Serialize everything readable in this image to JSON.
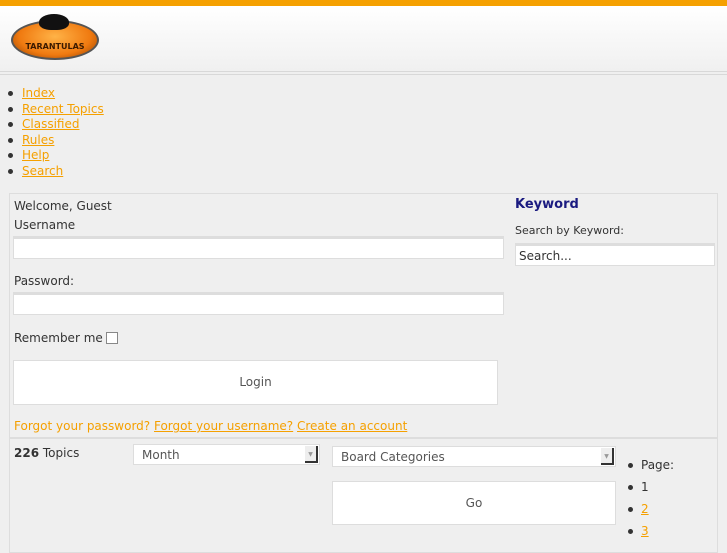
{
  "logo": {
    "text": "TARANTULAS"
  },
  "nav": [
    {
      "label": "Index"
    },
    {
      "label": "Recent Topics"
    },
    {
      "label": "Classified"
    },
    {
      "label": "Rules"
    },
    {
      "label": "Help"
    },
    {
      "label": "Search"
    }
  ],
  "login": {
    "welcome": "Welcome, Guest",
    "username_label": "Username",
    "password_label": "Password:",
    "remember_label": "Remember me",
    "login_button": "Login",
    "forgot_password": "Forgot your password?",
    "forgot_username": "Forgot your username?",
    "create_account": "Create an account"
  },
  "search": {
    "heading": "Keyword",
    "label": "Search by Keyword:",
    "value": "Search..."
  },
  "topics": {
    "count": "226",
    "label": "Topics",
    "month_select": "Month",
    "category_select": "Board Categories",
    "go_button": "Go"
  },
  "pagination": {
    "label": "Page:",
    "current": "1",
    "pages": [
      "2",
      "3"
    ]
  },
  "colors": {
    "accent": "#f5a000",
    "heading": "#1a1a80"
  }
}
